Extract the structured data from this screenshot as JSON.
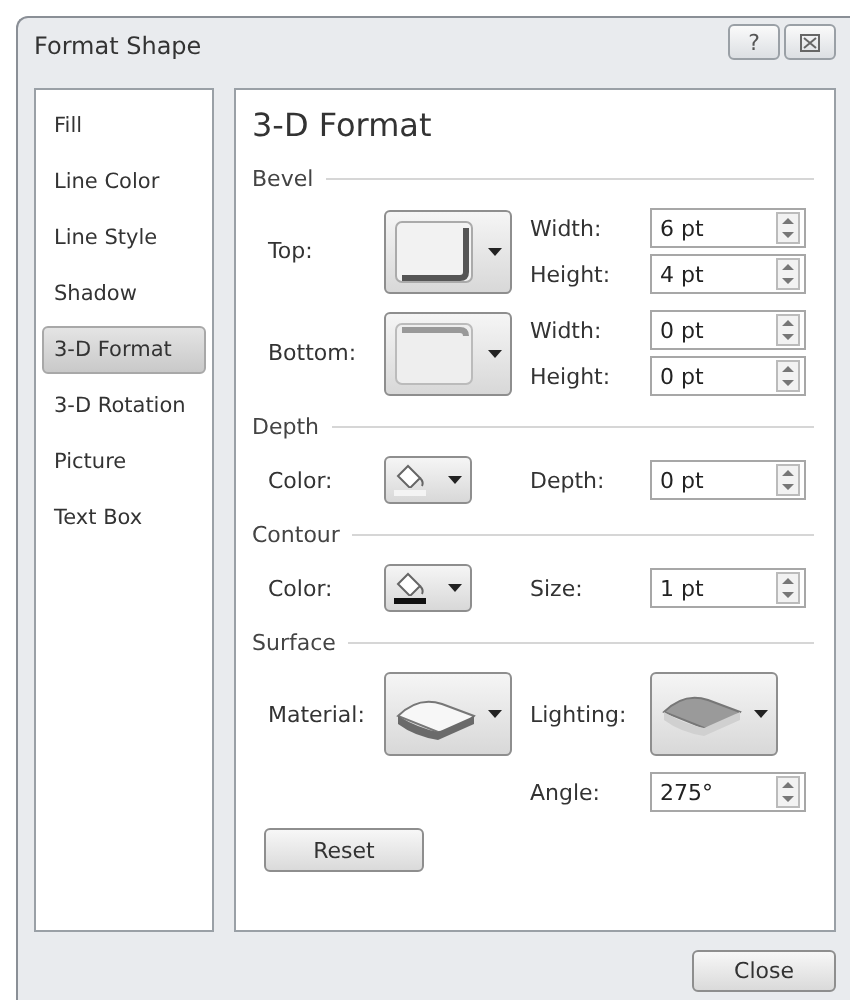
{
  "window": {
    "title": "Format Shape",
    "help_button": "?"
  },
  "sidebar": {
    "items": [
      {
        "label": "Fill",
        "selected": false
      },
      {
        "label": "Line Color",
        "selected": false
      },
      {
        "label": "Line Style",
        "selected": false
      },
      {
        "label": "Shadow",
        "selected": false
      },
      {
        "label": "3-D Format",
        "selected": true
      },
      {
        "label": "3-D Rotation",
        "selected": false
      },
      {
        "label": "Picture",
        "selected": false
      },
      {
        "label": "Text Box",
        "selected": false
      }
    ]
  },
  "panel": {
    "title": "3-D Format",
    "sections": [
      {
        "title": "Bevel",
        "rows": [
          {
            "kind": "picker_fields",
            "label": "Top:",
            "picker": {
              "kind": "bevel_top"
            },
            "fields": [
              {
                "label": "Width:",
                "value": "6 pt"
              },
              {
                "label": "Height:",
                "value": "4 pt"
              }
            ]
          },
          {
            "kind": "picker_fields",
            "label": "Bottom:",
            "picker": {
              "kind": "bevel_bottom"
            },
            "fields": [
              {
                "label": "Width:",
                "value": "0 pt"
              },
              {
                "label": "Height:",
                "value": "0 pt"
              }
            ]
          }
        ]
      },
      {
        "title": "Depth",
        "rows": [
          {
            "kind": "picker_fields",
            "label": "Color:",
            "picker": {
              "kind": "color",
              "color": "#f4f4f4"
            },
            "fields": [
              {
                "label": "Depth:",
                "value": "0 pt"
              }
            ]
          }
        ]
      },
      {
        "title": "Contour",
        "rows": [
          {
            "kind": "picker_fields",
            "label": "Color:",
            "picker": {
              "kind": "color",
              "color": "#111111"
            },
            "fields": [
              {
                "label": "Size:",
                "value": "1 pt"
              }
            ]
          }
        ]
      },
      {
        "title": "Surface",
        "rows": [
          {
            "kind": "two_pickers",
            "label": "Material:",
            "picker": {
              "kind": "material"
            },
            "label2": "Lighting:",
            "picker2": {
              "kind": "lighting"
            }
          },
          {
            "kind": "field_only",
            "fields": [
              {
                "label": "Angle:",
                "value": "275°"
              }
            ]
          }
        ]
      }
    ],
    "reset_button": "Reset"
  },
  "close_button": "Close"
}
